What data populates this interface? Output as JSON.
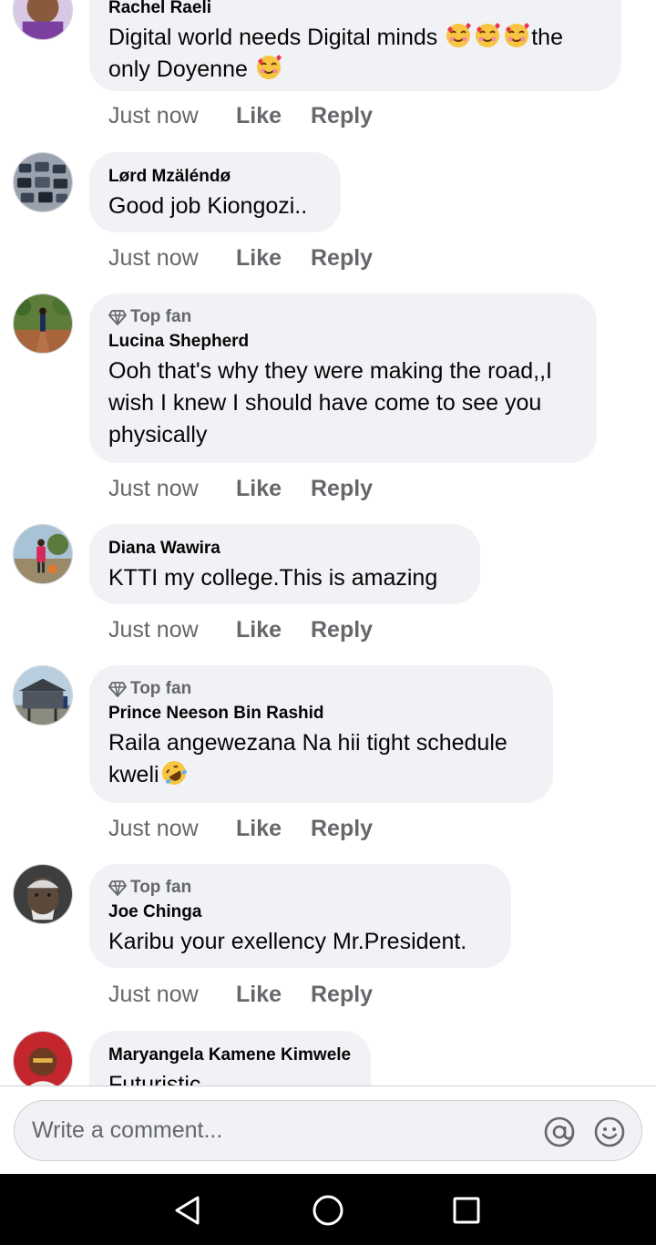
{
  "comments": [
    {
      "author": "Rachel Raeli",
      "top_fan": false,
      "text_lines": [
        "Digital world needs Digital minds ",
        "the",
        "only Doyenne "
      ],
      "emojis": [
        "smiling-face-with-hearts-emoji",
        "smiling-face-with-hearts-emoji",
        "smiling-face-with-hearts-emoji",
        "smiling-face-with-hearts-emoji"
      ],
      "time": "Just now",
      "like": "Like",
      "reply": "Reply"
    },
    {
      "author": "Lørd Mzäléndø",
      "top_fan": false,
      "text": "Good job Kiongozi..",
      "time": "Just now",
      "like": "Like",
      "reply": "Reply"
    },
    {
      "author": "Lucina Shepherd",
      "top_fan": true,
      "badge": "Top fan",
      "text": "Ooh that's why they were making the road,,I wish I knew I should have come to see you physically",
      "time": "Just now",
      "like": "Like",
      "reply": "Reply"
    },
    {
      "author": "Diana Wawira",
      "top_fan": false,
      "text": "KTTI my college.This is amazing",
      "time": "Just now",
      "like": "Like",
      "reply": "Reply"
    },
    {
      "author": "Prince Neeson Bin Rashid",
      "top_fan": true,
      "badge": "Top fan",
      "text_lines": [
        "Raila angewezana Na hii tight schedule",
        "kweli"
      ],
      "emojis": [
        "rolling-on-floor-laughing-emoji"
      ],
      "time": "Just now",
      "like": "Like",
      "reply": "Reply"
    },
    {
      "author": "Joe Chinga",
      "top_fan": true,
      "badge": "Top fan",
      "text": "Karibu your exellency Mr.President.",
      "time": "Just now",
      "like": "Like",
      "reply": "Reply"
    },
    {
      "author": "Maryangela Kamene Kimwele",
      "top_fan": false,
      "text": "Futuristic"
    }
  ],
  "composer": {
    "placeholder": "Write a comment...",
    "mention_icon": "at-icon",
    "emoji_icon": "smiley-icon"
  },
  "navbar": {
    "back_icon": "back-triangle-icon",
    "home_icon": "home-circle-icon",
    "recents_icon": "recents-square-icon"
  },
  "colors": {
    "bubble": "#f0f2f5",
    "secondary_text": "#65676b",
    "primary_text": "#050505",
    "navbar": "#000000"
  }
}
